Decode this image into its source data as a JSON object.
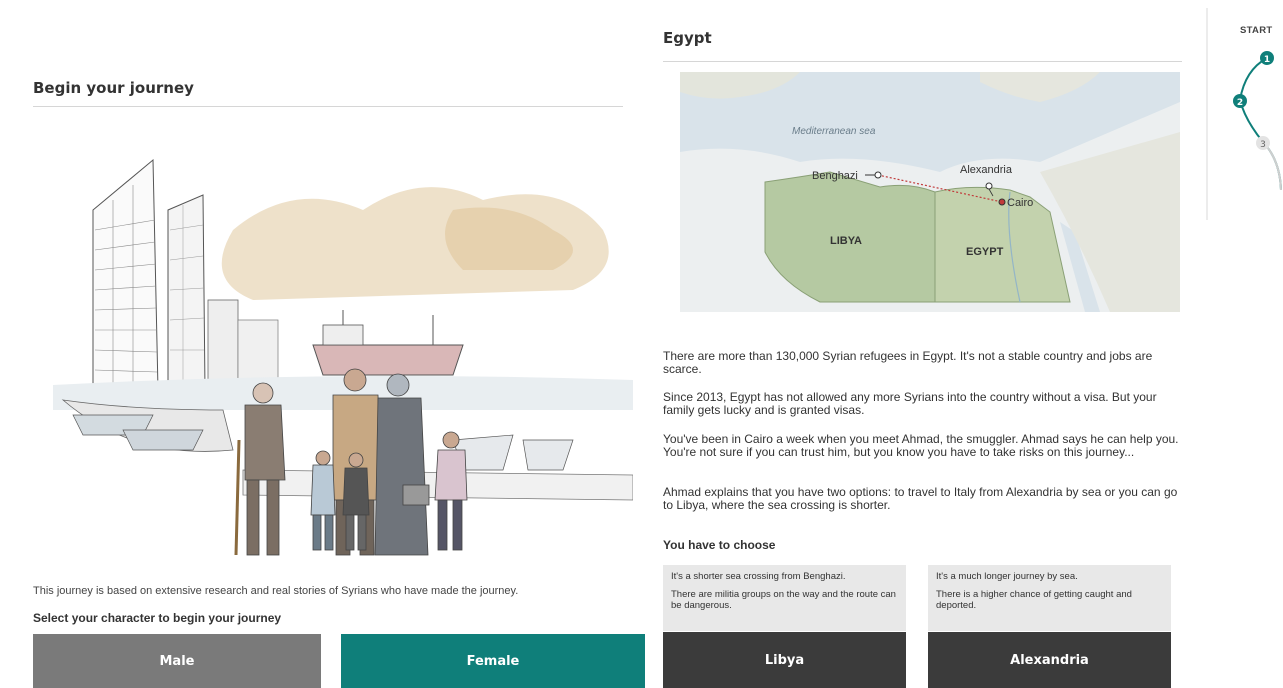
{
  "left": {
    "title": "Begin your journey",
    "intro": "This journey is based on extensive research and real stories of Syrians who have made the journey.",
    "select_label": "Select your character to begin your journey",
    "buttons": {
      "male": "Male",
      "female": "Female"
    },
    "colors": {
      "male": "#7a7a7a",
      "female": "#0f7f7a"
    }
  },
  "right": {
    "title": "Egypt",
    "map": {
      "sea_label": "Mediterranean sea",
      "cities": [
        "Benghazi",
        "Alexandria",
        "Cairo"
      ],
      "countries": [
        "LIBYA",
        "EGYPT"
      ]
    },
    "paragraphs": [
      "There are more than 130,000 Syrian refugees in Egypt. It's not a stable country and jobs are scarce.",
      "Since 2013, Egypt has not allowed any more Syrians into the country without a visa. But your family gets lucky and is granted visas.",
      "You've been in Cairo a week when you meet Ahmad, the smuggler. Ahmad says he can help you. You're not sure if you can trust him, but you know you have to take risks on this journey...",
      "Ahmad explains that you have two options: to travel to Italy from Alexandria by sea or you can go to Libya, where the sea crossing is shorter."
    ],
    "choose_label": "You have to choose",
    "choices": [
      {
        "lines": [
          "It's a shorter sea crossing from Benghazi.",
          "There are militia groups on the way and the route can be dangerous."
        ],
        "button": "Libya"
      },
      {
        "lines": [
          "It's a much longer journey by sea.",
          "There is a higher chance of getting caught and deported."
        ],
        "button": "Alexandria"
      }
    ]
  },
  "progress": {
    "start_label": "START",
    "steps": [
      "1",
      "2",
      "3"
    ],
    "active_color": "#0f7f7a"
  }
}
